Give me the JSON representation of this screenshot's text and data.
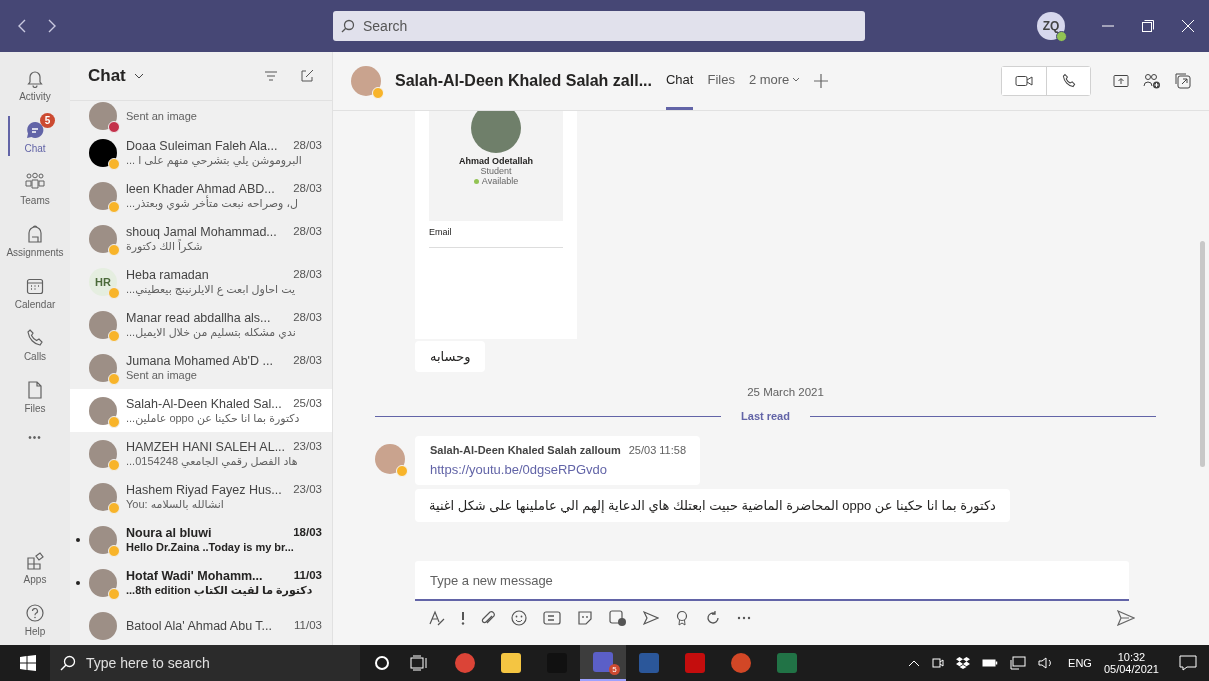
{
  "titlebar": {
    "search_placeholder": "Search",
    "avatar_initials": "ZQ"
  },
  "rail": {
    "items": [
      {
        "label": "Activity",
        "selected": false
      },
      {
        "label": "Chat",
        "selected": true,
        "badge": "5"
      },
      {
        "label": "Teams",
        "selected": false
      },
      {
        "label": "Assignments",
        "selected": false
      },
      {
        "label": "Calendar",
        "selected": false
      },
      {
        "label": "Calls",
        "selected": false
      },
      {
        "label": "Files",
        "selected": false
      }
    ],
    "more": "•••",
    "bottom_items": [
      {
        "label": "Apps",
        "selected": false
      },
      {
        "label": "Help",
        "selected": false
      }
    ]
  },
  "chat_list": {
    "title": "Chat",
    "items": [
      {
        "preview": "Sent an image",
        "color": "#c4314b",
        "unread": false,
        "selected": false
      },
      {
        "name": "Doaa Suleiman Faleh Ala...",
        "date": "28/03",
        "preview": "البروموشن يلي بتشرحي منهم على ا ...",
        "color": "#f8b42a",
        "unread": false,
        "selected": false
      },
      {
        "name": "leen Khader Ahmad ABD...",
        "date": "28/03",
        "preview": "ل، وصراحه نبعت متأخر شوي وبعتذر...",
        "color": "#f8b42a",
        "unread": false,
        "selected": false
      },
      {
        "name": "shouq Jamal Mohammad...",
        "date": "28/03",
        "preview": "شكراً الك دكتورة",
        "color": "#f8b42a",
        "unread": false,
        "selected": false
      },
      {
        "name": "Heba ramadan",
        "date": "28/03",
        "preview": "يت احاول ابعت ع الايلرنينج بيعطيني...",
        "color": "#f8b42a",
        "initials": "HR",
        "unread": false,
        "selected": false
      },
      {
        "name": "Manar read abdallha als...",
        "date": "28/03",
        "preview": "ندي مشكله بتسليم من خلال الايميل...",
        "color": "#f8b42a",
        "unread": false,
        "selected": false
      },
      {
        "name": "Jumana Mohamed Ab'D ...",
        "date": "28/03",
        "preview": "Sent an image",
        "color": "#f8b42a",
        "unread": false,
        "selected": false
      },
      {
        "name": "Salah-Al-Deen Khaled Sal...",
        "date": "25/03",
        "preview": "دكتورة بما انا حكينا عن oppo عاملين...",
        "color": "#f8b42a",
        "unread": false,
        "selected": true
      },
      {
        "name": "HAMZEH HANI SALEH AL...",
        "date": "23/03",
        "preview": "هاد الفصل رقمي الجامعي 0154248...",
        "color": "#f8b42a",
        "unread": false,
        "selected": false
      },
      {
        "name": "Hashem Riyad Fayez Hus...",
        "date": "23/03",
        "preview": "You: انشالله بالسلامه",
        "color": "#f8b42a",
        "unread": false,
        "selected": false
      },
      {
        "name": "Noura al bluwi",
        "date": "18/03",
        "preview": "Hello Dr.Zaina ..Today is my br...",
        "color": "#f8b42a",
        "unread": true,
        "selected": false
      },
      {
        "name": "Hotaf Wadi' Mohamm...",
        "date": "11/03",
        "preview": "دكتورة ما لقيت الكتاب 8th edition...",
        "color": "#f8b42a",
        "unread": true,
        "selected": false
      },
      {
        "name": "Batool Ala' Ahmad Abu T...",
        "date": "11/03",
        "unread": false,
        "selected": false
      }
    ]
  },
  "conversation": {
    "name": "Salah-Al-Deen Khaled Salah zall...",
    "color": "#f8b42a",
    "tabs": [
      {
        "label": "Chat",
        "selected": true
      },
      {
        "label": "Files",
        "selected": false
      }
    ],
    "more_tabs": "2 more",
    "profile_card": {
      "name": "Ahmad Odetallah",
      "role": "Student",
      "presence": "Available",
      "field": "Email"
    },
    "image_caption": "وحسابه",
    "date_divider": "25 March 2021",
    "last_read": "Last read",
    "message": {
      "sender": "Salah-Al-Deen Khaled Salah zalloum",
      "time": "25/03 11:58",
      "link": "https://youtu.be/0dgseRPGvdo",
      "text": "دكتورة بما انا حكينا عن oppo المحاضرة الماضية حبيت ابعتلك هاي الدعاية إلهم الي عاملينها على شكل اغنية"
    },
    "compose_placeholder": "Type a new message"
  },
  "taskbar": {
    "search_placeholder": "Type here to search",
    "apps": [
      {
        "kind": "chrome",
        "selected": false
      },
      {
        "kind": "explorer",
        "selected": false
      },
      {
        "kind": "netflix",
        "selected": false
      },
      {
        "kind": "teams",
        "selected": true,
        "badge": "5"
      },
      {
        "kind": "word",
        "selected": false
      },
      {
        "kind": "pdf",
        "selected": false
      },
      {
        "kind": "powerpoint",
        "selected": false
      },
      {
        "kind": "excel",
        "selected": false
      }
    ],
    "language": "ENG",
    "time": "10:32",
    "date": "05/04/2021"
  }
}
